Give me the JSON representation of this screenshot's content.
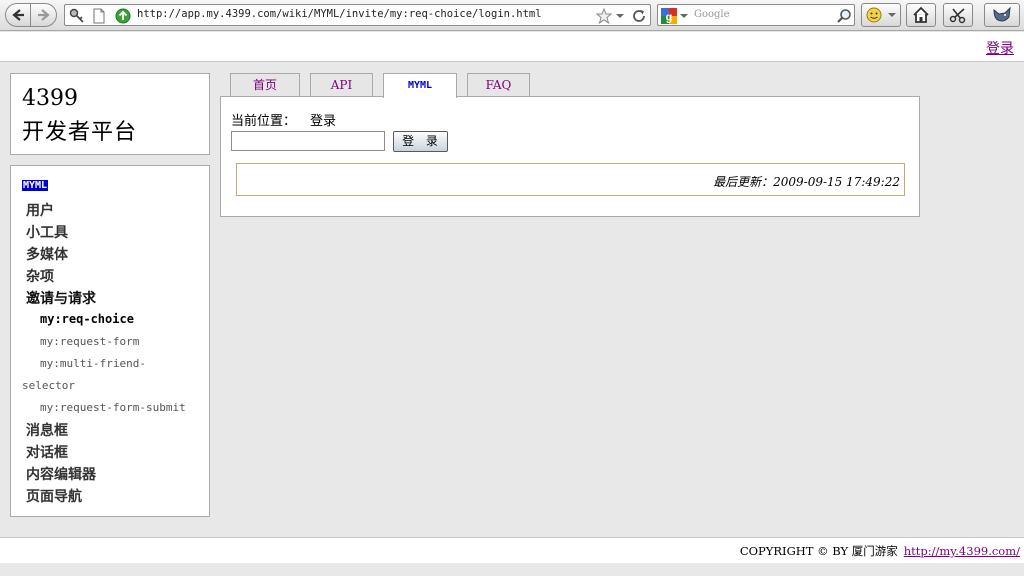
{
  "browser": {
    "url": "http://app.my.4399.com/wiki/MYML/invite/my:req-choice/login.html",
    "search_placeholder": "Google"
  },
  "header": {
    "login_link": "登录"
  },
  "logo": {
    "line1": "4399",
    "line2": "开发者平台"
  },
  "sidebar": {
    "heading": "MYML",
    "items": [
      "用户",
      "小工具",
      "多媒体",
      "杂项",
      "邀请与请求",
      "my:req-choice",
      "my:request-form",
      "my:multi-friend-",
      "selector",
      "my:request-form-submit",
      "消息框",
      "对话框",
      "内容编辑器",
      "页面导航"
    ]
  },
  "tabs": [
    {
      "label": "首页",
      "active": false
    },
    {
      "label": "API",
      "active": false
    },
    {
      "label": "MYML",
      "active": true
    },
    {
      "label": "FAQ",
      "active": false
    }
  ],
  "main": {
    "breadcrumb_label": "当前位置：",
    "breadcrumb_current": "登录",
    "username_value": "",
    "login_button": "登 录",
    "last_updated": "最后更新：2009-09-15 17:49:22"
  },
  "footer": {
    "copyright": "COPYRIGHT © BY 厦门游家",
    "link": "http://my.4399.com/"
  }
}
